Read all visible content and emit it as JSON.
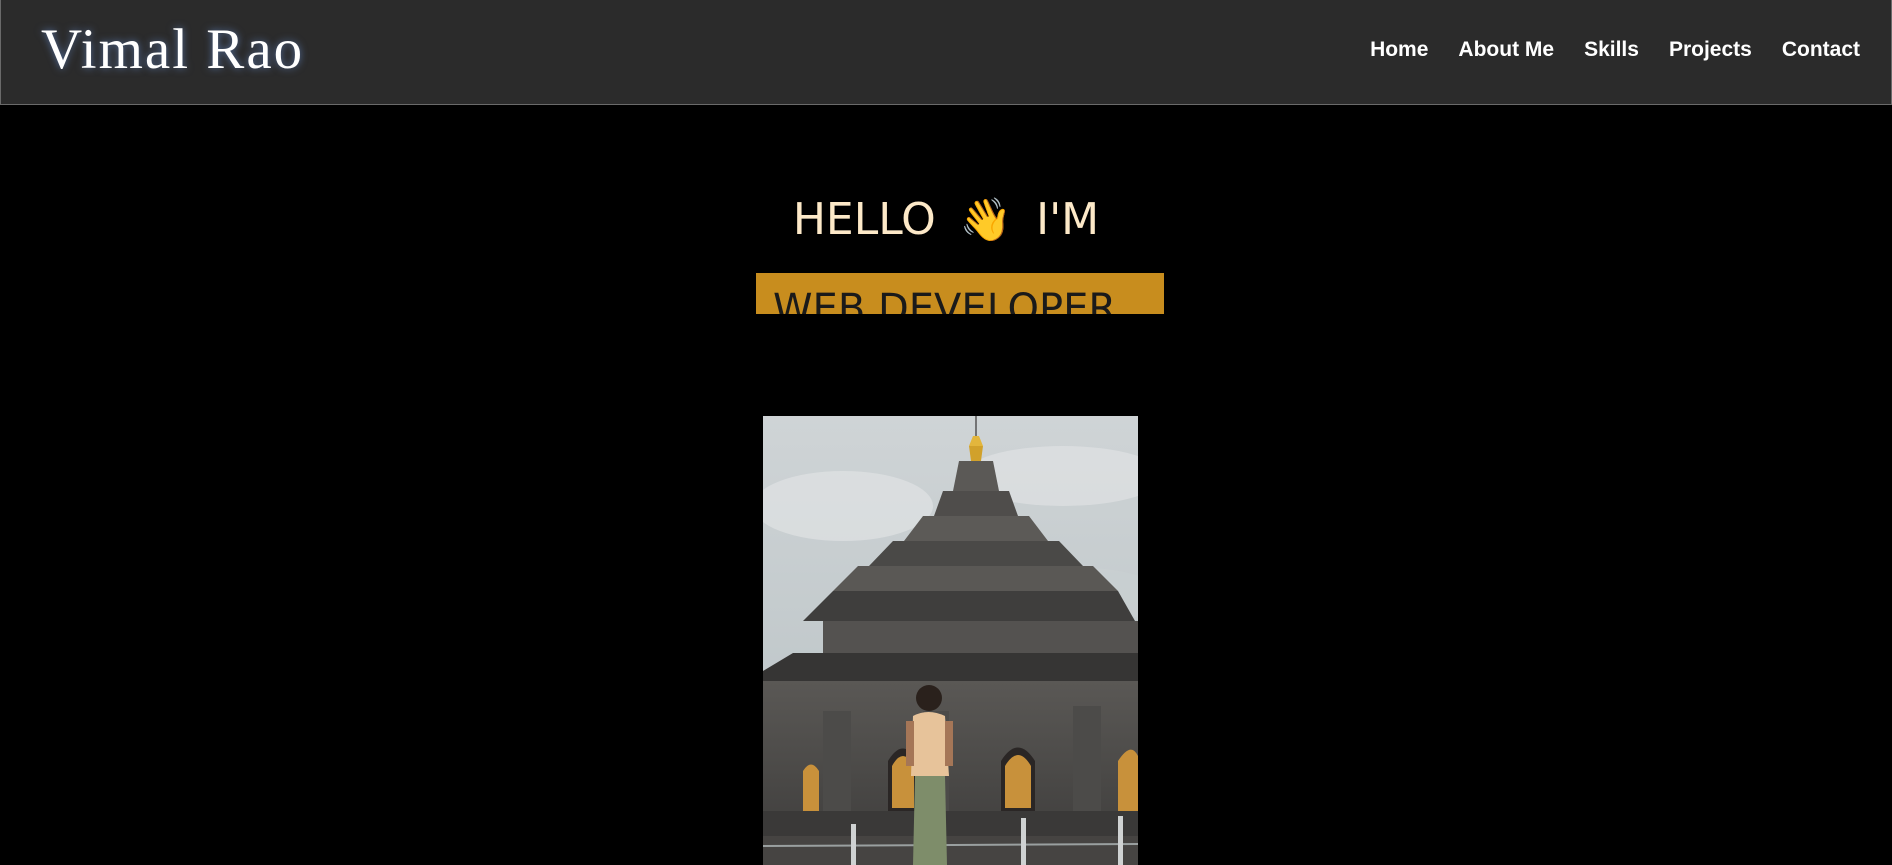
{
  "header": {
    "logo": "Vimal Rao",
    "nav": [
      "Home",
      "About Me",
      "Skills",
      "Projects",
      "Contact"
    ]
  },
  "hero": {
    "greeting_start": "HELLO",
    "wave_icon": "waving-hand-icon",
    "greeting_end": "I'M",
    "role": "WEB DEVELOPER"
  },
  "colors": {
    "header_bg": "#2b2b2b",
    "page_bg": "#000000",
    "greeting": "#fde9c8",
    "role_band": "#c88d1e"
  }
}
